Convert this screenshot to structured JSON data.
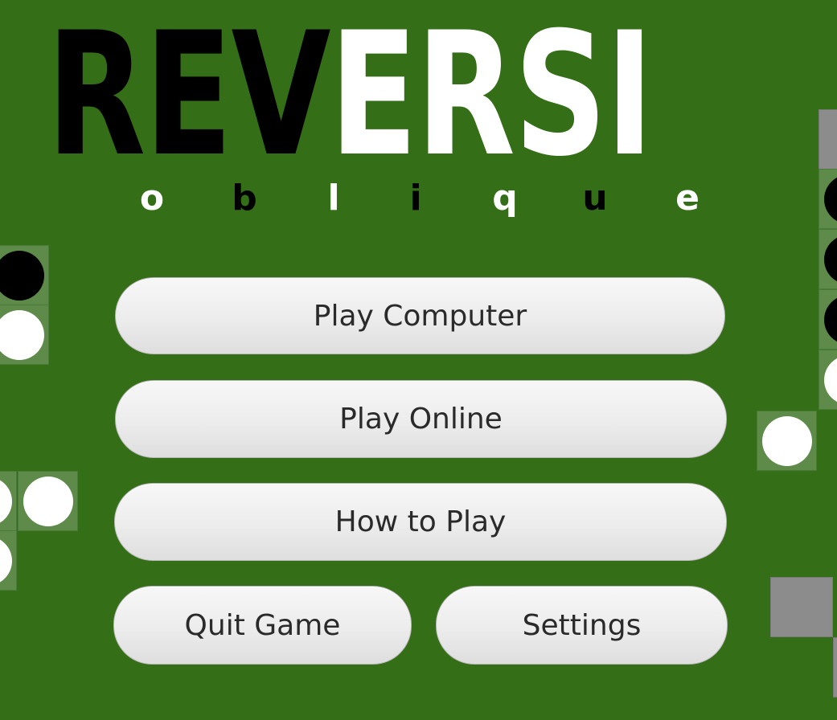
{
  "title": {
    "dark_part": "REV",
    "light_part": "ERSI",
    "subtitle_letters": [
      "o",
      "b",
      "l",
      "i",
      "q",
      "u",
      "e"
    ]
  },
  "menu": {
    "play_computer": "Play Computer",
    "play_online": "Play Online",
    "how_to_play": "How to Play",
    "quit_game": "Quit Game",
    "settings": "Settings"
  },
  "colors": {
    "background": "#346e16",
    "tile": "#5e8a4a",
    "tile_gray": "#8c8c8c",
    "black_disc": "#000000",
    "white_disc": "#ffffff",
    "button_text": "#2a2a2a"
  },
  "decor": {
    "tile_discs": [
      "black",
      "white",
      "white",
      "white",
      "white",
      "gray",
      "black",
      "black",
      "black",
      "white",
      "white",
      "gray",
      "gray"
    ]
  }
}
